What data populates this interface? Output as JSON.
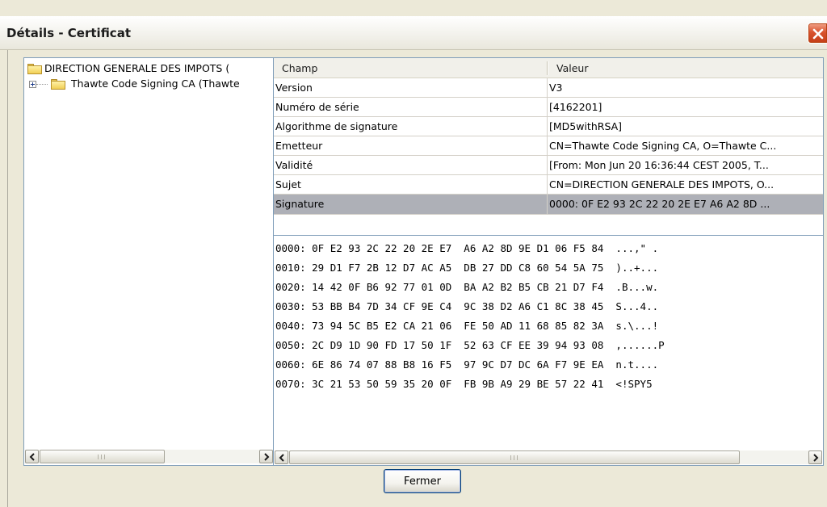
{
  "window": {
    "title": "Détails - Certificat",
    "close_icon": "close-icon"
  },
  "tree": {
    "items": [
      {
        "label": "DIRECTION GENERALE DES IMPOTS (",
        "icon": "folder-icon",
        "level": 0
      },
      {
        "label": "Thawte Code Signing CA (Thawte",
        "icon": "folder-icon",
        "level": 1,
        "expander": "plus-expander-icon"
      }
    ]
  },
  "table": {
    "columns": [
      "Champ",
      "Valeur"
    ],
    "rows": [
      {
        "field": "Version",
        "value": "V3"
      },
      {
        "field": "Numéro de série",
        "value": "[4162201]"
      },
      {
        "field": "Algorithme de signature",
        "value": "[MD5withRSA]"
      },
      {
        "field": "Emetteur",
        "value": "CN=Thawte Code Signing CA, O=Thawte C..."
      },
      {
        "field": "Validité",
        "value": "[From: Mon Jun 20 16:36:44 CEST 2005, T..."
      },
      {
        "field": "Sujet",
        "value": "CN=DIRECTION GENERALE DES IMPOTS, O..."
      },
      {
        "field": "Signature",
        "value": "0000: 0F E2 93 2C 22 20 2E E7  A6 A2 8D ...",
        "selected": true
      }
    ]
  },
  "hex": {
    "lines": [
      "0000: 0F E2 93 2C 22 20 2E E7  A6 A2 8D 9E D1 06 F5 84  ...,\" .",
      "0010: 29 D1 F7 2B 12 D7 AC A5  DB 27 DD C8 60 54 5A 75  )..+...",
      "0020: 14 42 0F B6 92 77 01 0D  BA A2 B2 B5 CB 21 D7 F4  .B...w.",
      "0030: 53 BB B4 7D 34 CF 9E C4  9C 38 D2 A6 C1 8C 38 45  S...4..",
      "0040: 73 94 5C B5 E2 CA 21 06  FE 50 AD 11 68 85 82 3A  s.\\...!",
      "0050: 2C D9 1D 90 FD 17 50 1F  52 63 CF EE 39 94 93 08  ,......P",
      "0060: 6E 86 74 07 88 B8 16 F5  97 9C D7 DC 6A F7 9E EA  n.t....",
      "0070: 3C 21 53 50 59 35 20 0F  FB 9B A9 29 BE 57 22 41  <!SPY5 "
    ]
  },
  "buttons": {
    "close_label": "Fermer"
  },
  "colors": {
    "selected_row": "#aeb0b7",
    "panel_border": "#7f9db9",
    "dialog_bg": "#ece9d8",
    "close_button": "#d9532e"
  }
}
